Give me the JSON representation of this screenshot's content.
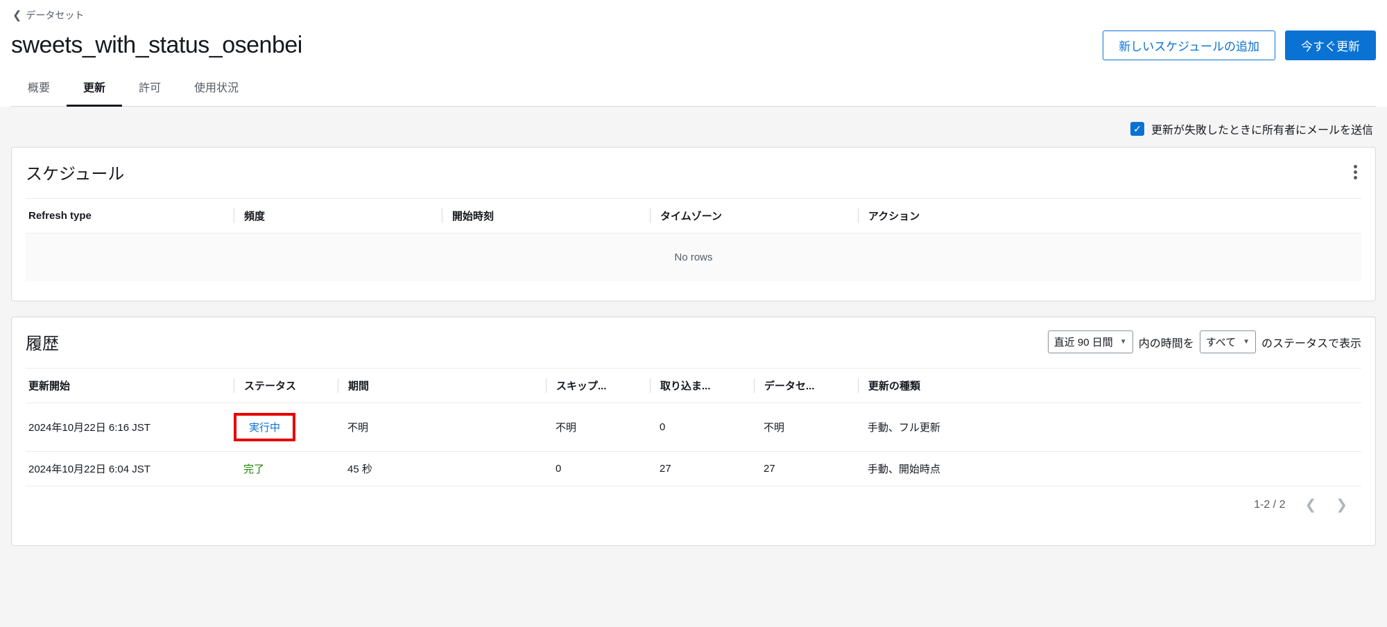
{
  "breadcrumb": {
    "label": "データセット"
  },
  "page": {
    "title": "sweets_with_status_osenbei"
  },
  "buttons": {
    "add_schedule": "新しいスケジュールの追加",
    "refresh_now": "今すぐ更新"
  },
  "tabs": {
    "overview": "概要",
    "refresh": "更新",
    "permissions": "許可",
    "usage": "使用状況"
  },
  "mail": {
    "label": "更新が失敗したときに所有者にメールを送信"
  },
  "schedule": {
    "title": "スケジュール",
    "cols": {
      "refresh_type": "Refresh type",
      "frequency": "頻度",
      "start": "開始時刻",
      "tz": "タイムゾーン",
      "action": "アクション"
    },
    "empty": "No rows"
  },
  "history": {
    "title": "履歴",
    "filter": {
      "range": "直近 90 日間",
      "mid": "内の時間を",
      "status": "すべて",
      "tail": "のステータスで表示"
    },
    "cols": {
      "start": "更新開始",
      "status": "ステータス",
      "duration": "期間",
      "skipped": "スキップ...",
      "imported": "取り込ま...",
      "dataset": "データセ...",
      "type": "更新の種類"
    },
    "rows": [
      {
        "start": "2024年10月22日 6:16 JST",
        "status": "実行中",
        "status_kind": "running",
        "duration": "不明",
        "skipped": "不明",
        "imported": "0",
        "dataset": "不明",
        "type": "手動、フル更新"
      },
      {
        "start": "2024年10月22日 6:04 JST",
        "status": "完了",
        "status_kind": "complete",
        "duration": "45 秒",
        "skipped": "0",
        "imported": "27",
        "dataset": "27",
        "type": "手動、開始時点"
      }
    ],
    "pager": "1-2 / 2"
  }
}
